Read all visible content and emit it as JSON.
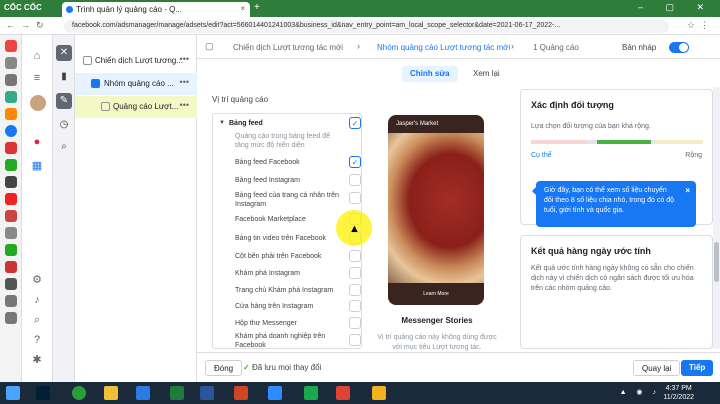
{
  "browser": {
    "logo": "CỐC CỐC",
    "tab_title": "Trình quản lý quảng cáo - Q...",
    "tab_close": "×",
    "new_tab": "+",
    "url": "facebook.com/adsmanager/manage/adsets/edit?act=566014401241003&business_id&nav_entry_point=am_local_scope_selector&date=2021-06-17_2022-...",
    "window_controls": "– ▢ ✕"
  },
  "tree": {
    "items": [
      {
        "label": "Chiến dịch Lượt tương...",
        "more": "•••"
      },
      {
        "label": "Nhóm quảng cáo ...",
        "more": "•••"
      },
      {
        "label": "Quảng cáo Lượt...",
        "more": "•••"
      }
    ]
  },
  "breadcrumb": {
    "campaign": "Chiến dịch Lượt tương tác mới",
    "adset": "Nhóm quảng cáo Lượt tương tác mới",
    "ad": "1 Quảng cáo",
    "draft": "Bản nháp"
  },
  "edit_tabs": {
    "edit": "Chỉnh sửa",
    "preview": "Xem lại"
  },
  "placements": {
    "section_title": "Vị trí quảng cáo",
    "group_title": "Bảng feed",
    "group_desc": "Quảng cáo trong bảng feed để tăng mức độ hiển diện",
    "items": [
      {
        "label": "Bảng feed Facebook",
        "checked": true
      },
      {
        "label": "Bảng feed Instagram",
        "checked": false
      },
      {
        "label": "Bảng feed của trang cá nhân trên Instagram",
        "checked": false
      },
      {
        "label": "Facebook Marketplace",
        "checked": false
      },
      {
        "label": "Bảng tin video trên Facebook",
        "checked": false
      },
      {
        "label": "Cột bên phải trên Facebook",
        "checked": false
      },
      {
        "label": "Khám phá Instagram",
        "checked": false
      },
      {
        "label": "Trang chủ Khám phá Instagram",
        "checked": false
      },
      {
        "label": "Cửa hàng trên Instagram",
        "checked": false
      },
      {
        "label": "Hộp thư Messenger",
        "checked": false
      },
      {
        "label": "Khám phá doanh nghiệp trên Facebook",
        "checked": false
      }
    ]
  },
  "preview": {
    "page_name": "Jasper's Market",
    "cta": "Learn More",
    "caption": "Messenger Stories",
    "note": "Vị trí quảng cáo này không dùng được với mục tiêu Lượt tương tác."
  },
  "audience": {
    "title": "Xác định đối tượng",
    "desc": "Lựa chọn đối tượng của bạn khá rộng.",
    "left": "Cụ thể",
    "right": "Rộng"
  },
  "tooltip": {
    "text": "Giờ đây, bạn có thể xem số liệu chuyển đổi theo 8 số liệu chia nhỏ, trong đó có độ tuổi, giới tính và quốc gia.",
    "close": "×"
  },
  "results": {
    "title": "Kết quả hàng ngày ước tính",
    "desc": "Kết quả ước tính hàng ngày không có sẵn cho chiến dịch này vì chiến dịch có ngân sách được tối ưu hóa trên các nhóm quảng cáo."
  },
  "footer": {
    "close": "Đóng",
    "saved": "Đã lưu mọi thay đổi",
    "back": "Quay lại",
    "next": "Tiếp"
  },
  "taskbar": {
    "time": "4:37 PM",
    "date": "11/2/2022"
  },
  "colors": {
    "accent": "#1877f2",
    "browser": "#2f7d3a"
  }
}
